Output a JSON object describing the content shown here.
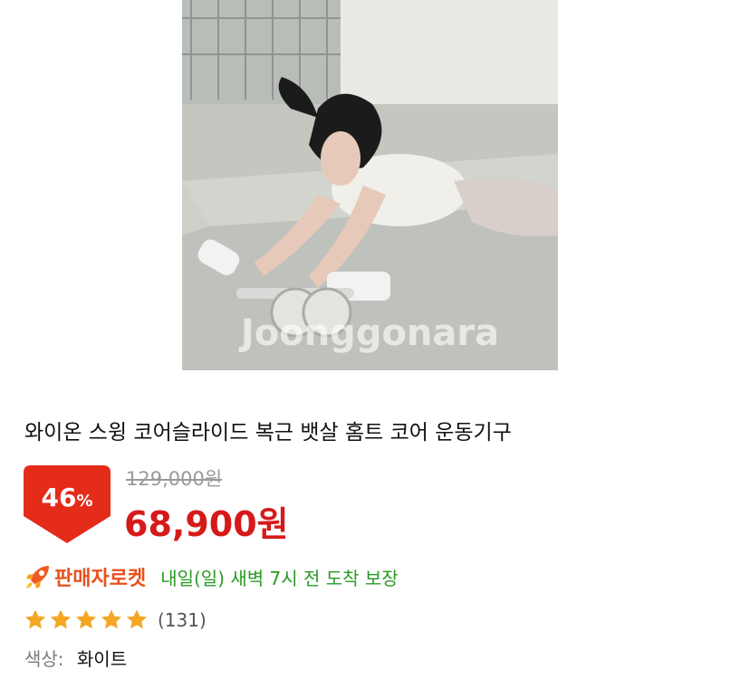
{
  "product": {
    "image_watermark": "Joonggonara",
    "title": "와이온 스윙 코어슬라이드 복근 뱃살 홈트 코어 운동기구",
    "discount_number": "46",
    "discount_unit": "%",
    "original_price": "129,000원",
    "sale_price": "68,900원",
    "delivery_badge": "판매자로켓",
    "delivery_text": "내일(일) 새벽 7시 전 도착 보장",
    "rating_stars": 5,
    "review_count": "(131)",
    "option_label": "색상:",
    "option_value": "화이트"
  },
  "colors": {
    "badge_red": "#e52b1a",
    "price_red": "#d51a1a",
    "rocket_orange": "#e8511e",
    "delivery_green": "#2a9a24",
    "star_orange": "#f5a623"
  },
  "icons": {
    "rocket": "rocket-icon",
    "star": "star-icon"
  }
}
